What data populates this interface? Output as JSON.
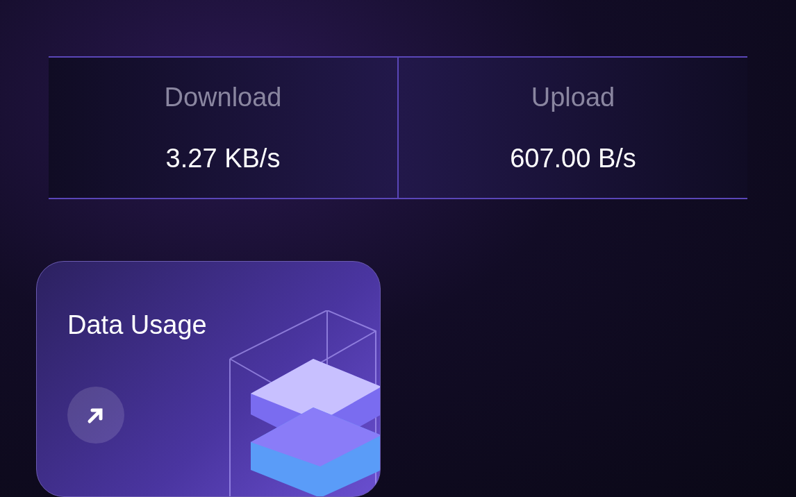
{
  "stats": [
    {
      "label": "Download",
      "value": "3.27 KB/s"
    },
    {
      "label": "Upload",
      "value": "607.00 B/s"
    }
  ],
  "card": {
    "title": "Data Usage"
  }
}
